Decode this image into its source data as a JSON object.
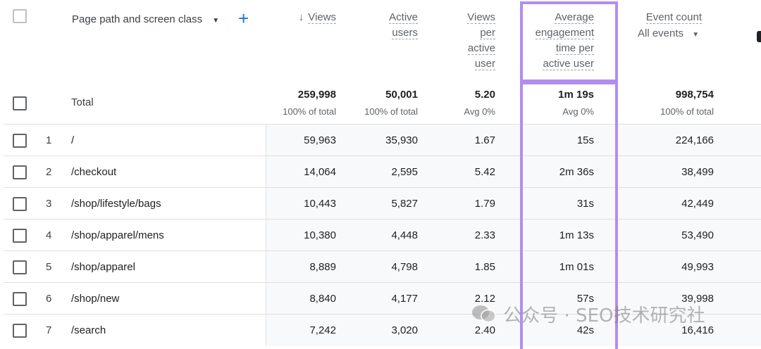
{
  "header": {
    "dimension_label": "Page path and screen class",
    "columns": [
      {
        "key": "views",
        "lines": [
          "Views"
        ],
        "sort_icon": "arrow-down-icon"
      },
      {
        "key": "active_users",
        "lines": [
          "Active",
          "users"
        ]
      },
      {
        "key": "views_per_user",
        "lines": [
          "Views",
          "per",
          "active",
          "user"
        ]
      },
      {
        "key": "avg_engagement",
        "lines": [
          "Average",
          "engagement",
          "time per",
          "active user"
        ]
      },
      {
        "key": "event_count",
        "lines": [
          "Event count"
        ],
        "sub_label": "All events"
      }
    ]
  },
  "total": {
    "label": "Total",
    "views": "259,998",
    "views_sub": "100% of total",
    "active_users": "50,001",
    "active_users_sub": "100% of total",
    "views_per_user": "5.20",
    "views_per_user_sub": "Avg 0%",
    "avg_engagement": "1m 19s",
    "avg_engagement_sub": "Avg 0%",
    "event_count": "998,754",
    "event_count_sub": "100% of total"
  },
  "rows": [
    {
      "rank": "1",
      "path": "/",
      "views": "59,963",
      "active_users": "35,930",
      "views_per_user": "1.67",
      "avg_engagement": "15s",
      "event_count": "224,166"
    },
    {
      "rank": "2",
      "path": "/checkout",
      "views": "14,064",
      "active_users": "2,595",
      "views_per_user": "5.42",
      "avg_engagement": "2m 36s",
      "event_count": "38,499"
    },
    {
      "rank": "3",
      "path": "/shop/lifestyle/bags",
      "views": "10,443",
      "active_users": "5,827",
      "views_per_user": "1.79",
      "avg_engagement": "31s",
      "event_count": "42,449"
    },
    {
      "rank": "4",
      "path": "/shop/apparel/mens",
      "views": "10,380",
      "active_users": "4,448",
      "views_per_user": "2.33",
      "avg_engagement": "1m 13s",
      "event_count": "53,490"
    },
    {
      "rank": "5",
      "path": "/shop/apparel",
      "views": "8,889",
      "active_users": "4,798",
      "views_per_user": "1.85",
      "avg_engagement": "1m 01s",
      "event_count": "49,993"
    },
    {
      "rank": "6",
      "path": "/shop/new",
      "views": "8,840",
      "active_users": "4,177",
      "views_per_user": "2.12",
      "avg_engagement": "57s",
      "event_count": "39,998"
    },
    {
      "rank": "7",
      "path": "/search",
      "views": "7,242",
      "active_users": "3,020",
      "views_per_user": "2.40",
      "avg_engagement": "42s",
      "event_count": "16,416"
    }
  ],
  "watermark": "公众号 · SEO技术研究社",
  "colors": {
    "highlight": "#b38cf0",
    "accent": "#1a73e8"
  }
}
